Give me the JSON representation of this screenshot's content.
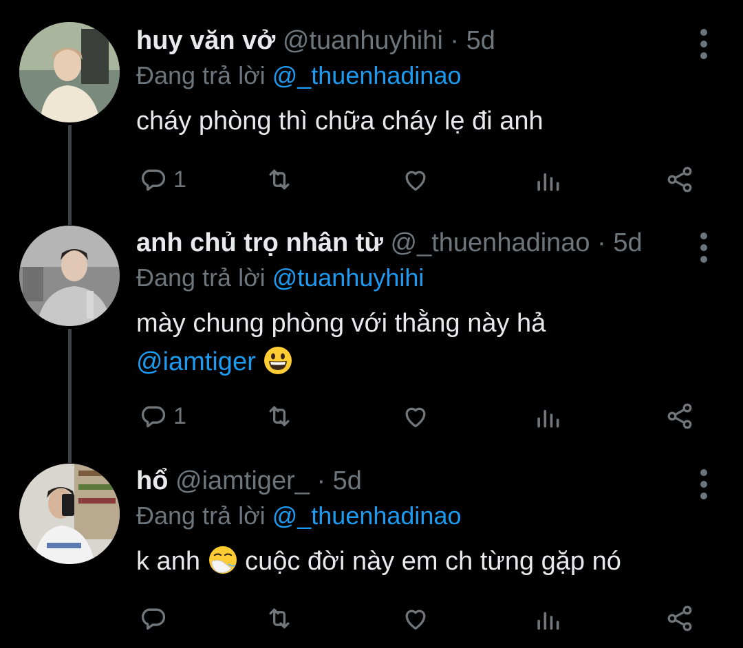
{
  "tweets": [
    {
      "name": "huy văn vở",
      "handle": "@tuanhuyhihi",
      "dot": "·",
      "time": "5d",
      "reply_prefix": "Đang trả lời",
      "reply_to": "@_thuenhadinao",
      "text_1": "cháy phòng thì chữa cháy lẹ đi anh",
      "reply_count": "1"
    },
    {
      "name": "anh chủ trọ nhân từ",
      "handle": "@_thuenhadinao",
      "dot": "·",
      "time": "5d",
      "reply_prefix": "Đang trả lời",
      "reply_to": "@tuanhuyhihi",
      "text_1": "mày chung phòng với thằng này hả",
      "text_mention": "@iamtiger",
      "emoji": "grinning-face-emoji",
      "reply_count": "1"
    },
    {
      "name": "hổ",
      "handle": "@iamtiger_",
      "dot": "·",
      "time": "5d",
      "reply_prefix": "Đang trả lời",
      "reply_to": "@_thuenhadinao",
      "text_before": "k anh",
      "emoji": "sneezing-face-emoji",
      "text_after": "cuộc đời này em ch từng gặp nó",
      "reply_count": ""
    }
  ],
  "icons": {
    "reply": "reply-icon",
    "retweet": "retweet-icon",
    "like": "heart-icon",
    "views": "analytics-icon",
    "share": "share-icon",
    "more": "more-vertical-icon"
  },
  "colors": {
    "background": "#000000",
    "text": "#e7e9ea",
    "secondary": "#6e767d",
    "link": "#1d9bf0",
    "thread_line": "#3d4248"
  }
}
